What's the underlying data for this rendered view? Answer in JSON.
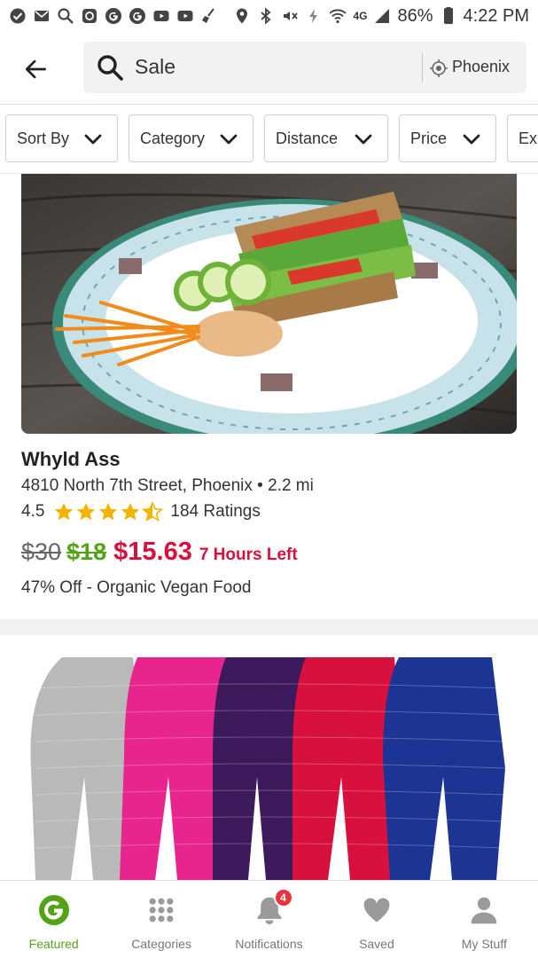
{
  "status_bar": {
    "battery": "86%",
    "time": "4:22 PM",
    "network": "4G",
    "left_icons": [
      "check-circle-icon",
      "mail-icon",
      "search-icon",
      "camera-icon",
      "google-icon",
      "google-icon",
      "youtube-icon",
      "youtube-icon",
      "broom-icon"
    ],
    "right_icons": [
      "location-icon",
      "bluetooth-icon",
      "mute-icon",
      "data-icon",
      "wifi-icon",
      "signal-icon",
      "battery-icon"
    ]
  },
  "search": {
    "query": "Sale",
    "location": "Phoenix"
  },
  "filters": [
    {
      "label": "Sort By"
    },
    {
      "label": "Category"
    },
    {
      "label": "Distance"
    },
    {
      "label": "Price"
    },
    {
      "label": "Exp"
    }
  ],
  "deals": [
    {
      "title": "Whyld Ass",
      "address": "4810 North 7th Street, Phoenix • 2.2 mi",
      "rating": "4.5",
      "rating_value": 4.5,
      "ratings_count": "184 Ratings",
      "price_original": "$30",
      "price_deal": "$18",
      "price_promo": "$15.63",
      "time_left": "7 Hours Left",
      "subtitle": "47% Off - Organic Vegan Food"
    }
  ],
  "bottom_nav": [
    {
      "label": "Featured",
      "icon": "groupon-logo-icon",
      "active": true
    },
    {
      "label": "Categories",
      "icon": "grid-dots-icon",
      "active": false
    },
    {
      "label": "Notifications",
      "icon": "bell-icon",
      "active": false,
      "badge": "4"
    },
    {
      "label": "Saved",
      "icon": "heart-icon",
      "active": false
    },
    {
      "label": "My Stuff",
      "icon": "person-icon",
      "active": false
    }
  ],
  "colors": {
    "brand_green": "#53a318",
    "promo_red": "#d8113a",
    "star_gold": "#f5b301",
    "badge_red": "#e8343f"
  }
}
